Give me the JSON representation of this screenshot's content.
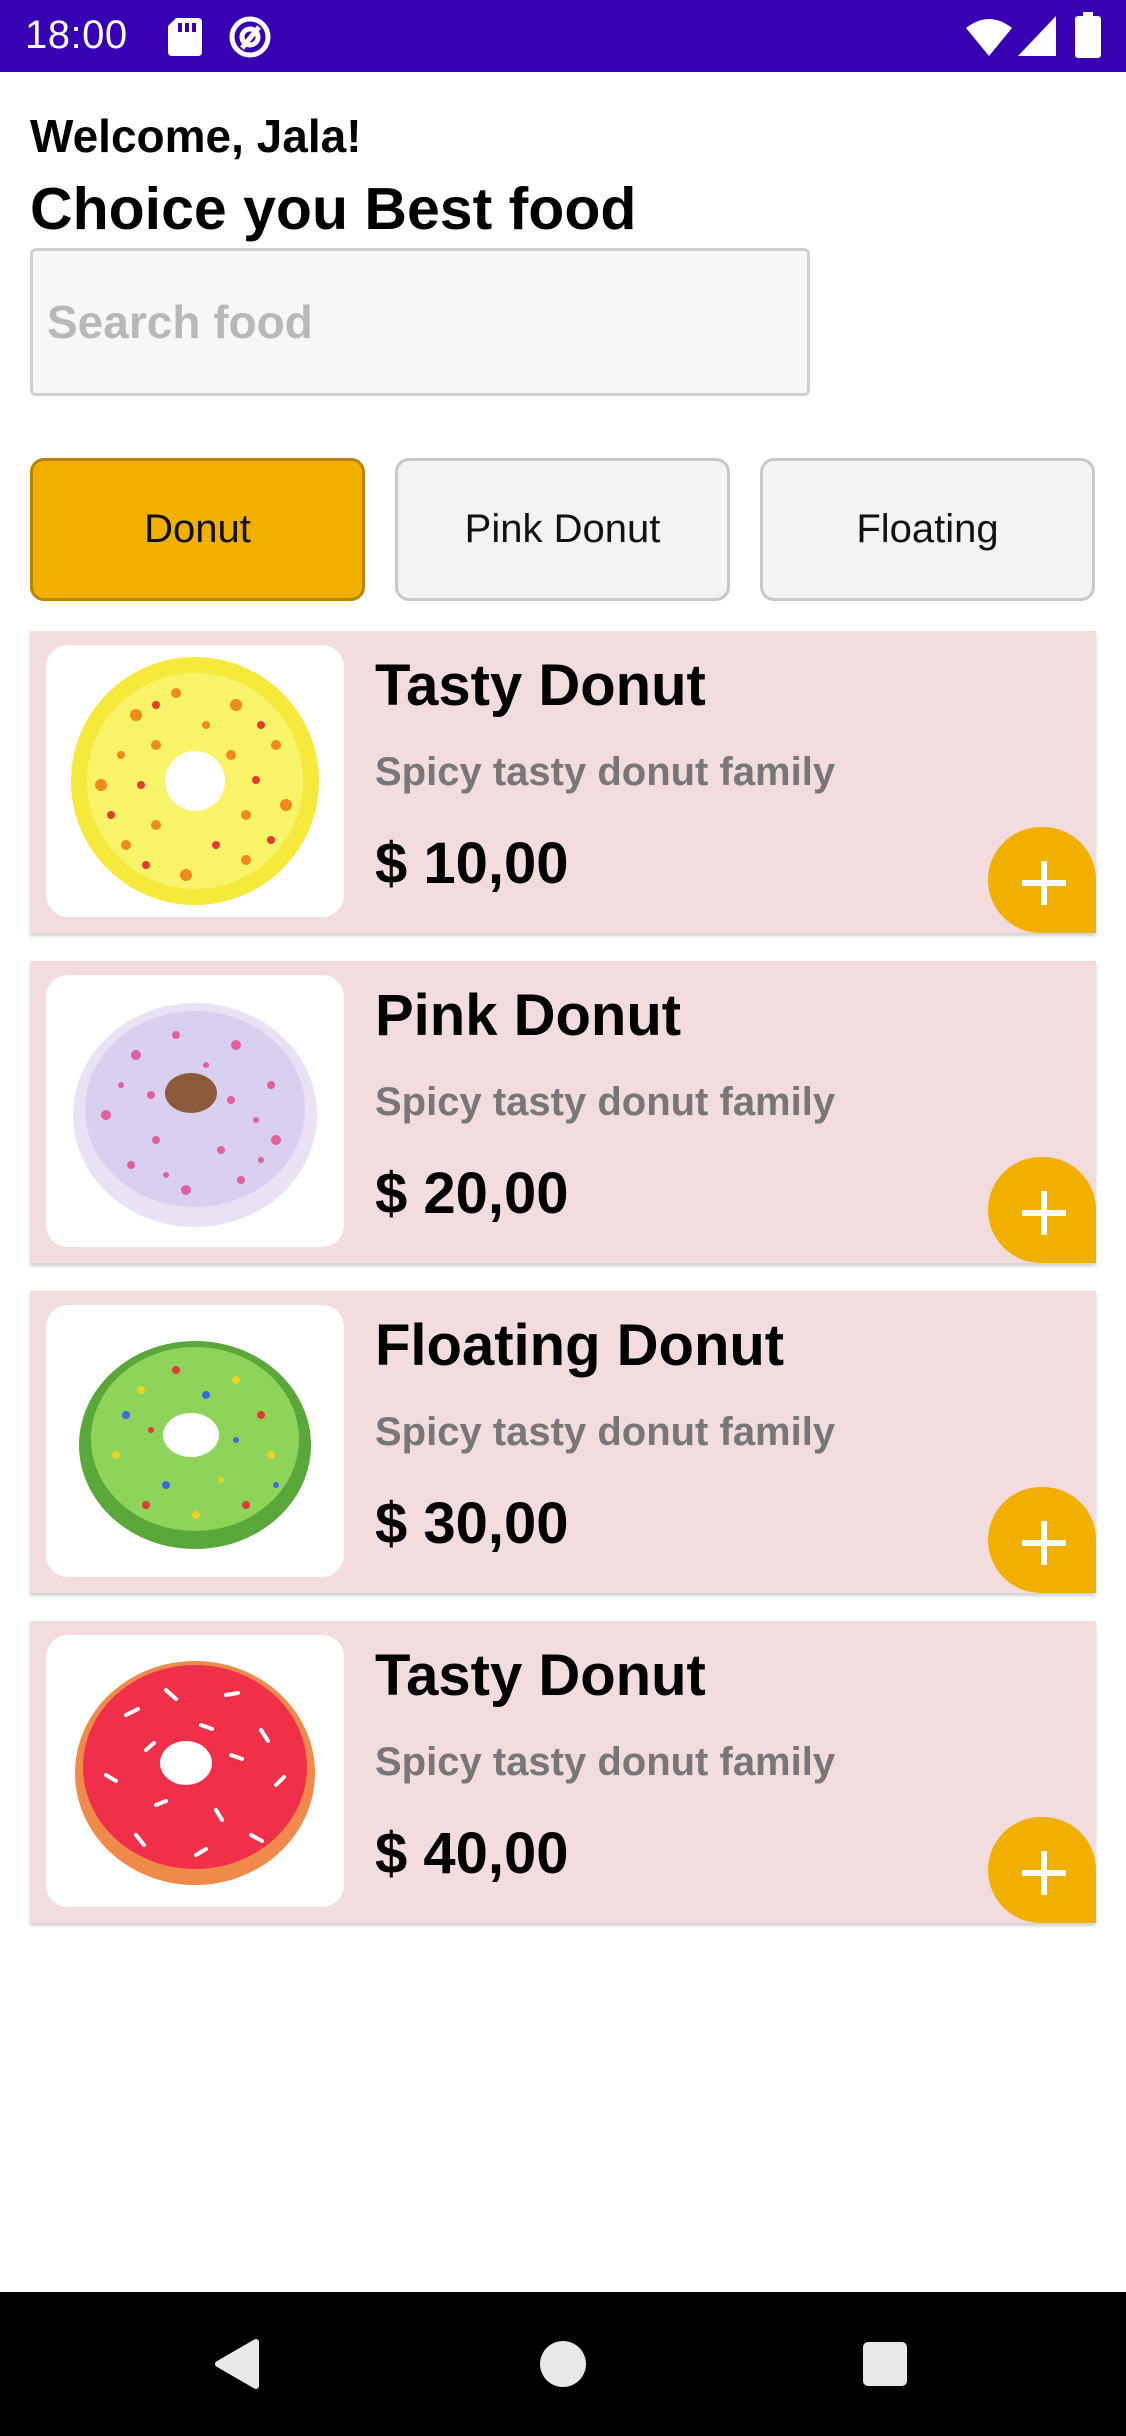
{
  "status_bar": {
    "time": "18:00",
    "background": "#3700b3",
    "icons": [
      "sd-card-icon",
      "at-sign-icon",
      "wifi-icon",
      "signal-icon",
      "battery-icon"
    ]
  },
  "header": {
    "welcome": "Welcome, Jala!",
    "headline": "Choice you Best food"
  },
  "search": {
    "placeholder": "Search food",
    "value": ""
  },
  "categories": [
    {
      "label": "Donut",
      "selected": true
    },
    {
      "label": "Pink Donut",
      "selected": false
    },
    {
      "label": "Floating",
      "selected": false
    }
  ],
  "foods": [
    {
      "title": "Tasty Donut",
      "description": "Spicy tasty donut family",
      "price": "$ 10,00",
      "image": "yellow-donut"
    },
    {
      "title": "Pink Donut",
      "description": "Spicy tasty donut family",
      "price": "$ 20,00",
      "image": "lavender-donut"
    },
    {
      "title": "Floating Donut",
      "description": "Spicy tasty donut family",
      "price": "$ 30,00",
      "image": "green-donut"
    },
    {
      "title": "Tasty Donut",
      "description": "Spicy tasty donut family",
      "price": "$ 40,00",
      "image": "red-donut"
    }
  ],
  "nav_bar": {
    "buttons": [
      "back-icon",
      "home-icon",
      "recents-icon"
    ]
  },
  "colors": {
    "accent": "#f1b000",
    "card_background": "#f2dcdd",
    "status_bar": "#3700b3"
  }
}
